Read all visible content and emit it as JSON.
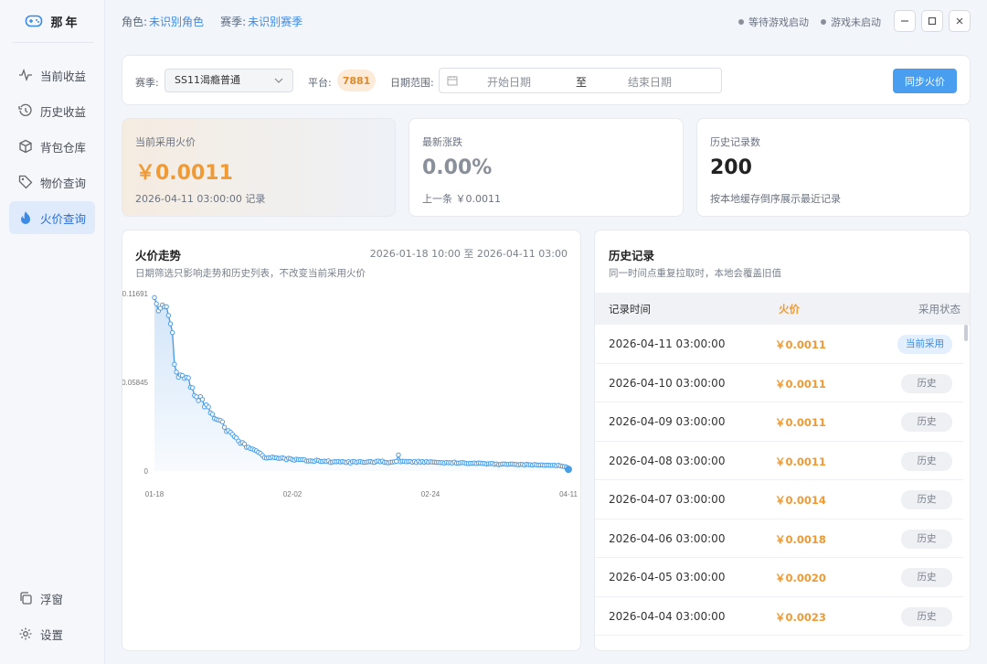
{
  "app": {
    "title": "那年"
  },
  "sidebar": {
    "items": [
      {
        "label": "当前收益",
        "icon": "pulse-icon",
        "active": false
      },
      {
        "label": "历史收益",
        "icon": "history-icon",
        "active": false
      },
      {
        "label": "背包仓库",
        "icon": "box-icon",
        "active": false
      },
      {
        "label": "物价查询",
        "icon": "tag-icon",
        "active": false
      },
      {
        "label": "火价查询",
        "icon": "flame-icon",
        "active": true
      }
    ],
    "bottom": [
      {
        "label": "浮窗",
        "icon": "copy-icon"
      },
      {
        "label": "设置",
        "icon": "gear-icon"
      }
    ]
  },
  "topbar": {
    "role_label": "角色:",
    "role_value": "未识别角色",
    "season_label": "赛季:",
    "season_value": "未识别赛季",
    "status1": "等待游戏启动",
    "status2": "游戏未启动"
  },
  "filter": {
    "season_label": "赛季:",
    "season_value": "SS11渴瘾普通",
    "platform_label": "平台:",
    "platform_value": "7881",
    "date_label": "日期范围:",
    "date_start": "开始日期",
    "date_to": "至",
    "date_end": "结束日期",
    "sync_label": "同步火价"
  },
  "cards": {
    "current": {
      "title": "当前采用火价",
      "value": "￥0.0011",
      "sub": "2026-04-11 03:00:00 记录"
    },
    "change": {
      "title": "最新涨跌",
      "value": "0.00%",
      "sub": "上一条 ￥0.0011"
    },
    "count": {
      "title": "历史记录数",
      "value": "200",
      "sub": "按本地缓存倒序展示最近记录"
    }
  },
  "chart_panel": {
    "title": "火价走势",
    "range": "2026-01-18 10:00 至 2026-04-11 03:00",
    "subtitle": "日期筛选只影响走势和历史列表，不改变当前采用火价"
  },
  "chart_data": {
    "type": "area",
    "ylim": [
      0,
      0.11691
    ],
    "yticks": [
      "0.11691",
      "0.05845",
      "0"
    ],
    "xticks": [
      "01-18",
      "02-02",
      "02-24",
      "04-11"
    ],
    "colors": {
      "line": "#4a9ee8",
      "fill": "#cfe3f8"
    },
    "values": [
      0.1143,
      0.1102,
      0.1055,
      0.1073,
      0.1094,
      0.1082,
      0.1083,
      0.1025,
      0.097,
      0.0912,
      0.0703,
      0.0652,
      0.0618,
      0.0633,
      0.0629,
      0.061,
      0.0617,
      0.0614,
      0.0552,
      0.0549,
      0.0497,
      0.0489,
      0.0464,
      0.0491,
      0.0471,
      0.0423,
      0.0436,
      0.0422,
      0.0383,
      0.0374,
      0.0346,
      0.0341,
      0.0336,
      0.0333,
      0.0324,
      0.0288,
      0.026,
      0.0266,
      0.0256,
      0.0241,
      0.0226,
      0.0218,
      0.0198,
      0.0182,
      0.0188,
      0.0178,
      0.0156,
      0.0157,
      0.0148,
      0.0145,
      0.0139,
      0.0133,
      0.0123,
      0.0116,
      0.0103,
      0.0089,
      0.0085,
      0.0088,
      0.0088,
      0.0092,
      0.0088,
      0.0088,
      0.0083,
      0.0084,
      0.0088,
      0.0083,
      0.0075,
      0.0084,
      0.0082,
      0.0075,
      0.0071,
      0.0078,
      0.0076,
      0.0076,
      0.0076,
      0.0074,
      0.0066,
      0.0066,
      0.0067,
      0.0065,
      0.0064,
      0.0072,
      0.0069,
      0.0063,
      0.0063,
      0.0066,
      0.0063,
      0.0067,
      0.0056,
      0.0059,
      0.0062,
      0.0061,
      0.0063,
      0.006,
      0.0063,
      0.006,
      0.0056,
      0.0062,
      0.0053,
      0.0062,
      0.0062,
      0.0057,
      0.0061,
      0.0062,
      0.0059,
      0.0057,
      0.0059,
      0.0061,
      0.0063,
      0.0059,
      0.0057,
      0.0064,
      0.0066,
      0.0061,
      0.0066,
      0.0057,
      0.0057,
      0.0054,
      0.0058,
      0.0059,
      0.0061,
      0.0064,
      0.0106,
      0.0061,
      0.0065,
      0.0064,
      0.0061,
      0.0063,
      0.0063,
      0.0058,
      0.0063,
      0.0056,
      0.0065,
      0.0058,
      0.0063,
      0.0057,
      0.0062,
      0.0058,
      0.0061,
      0.0059,
      0.0059,
      0.0057,
      0.0057,
      0.0055,
      0.0055,
      0.0053,
      0.0057,
      0.0055,
      0.0055,
      0.0053,
      0.0059,
      0.0052,
      0.0052,
      0.0054,
      0.0056,
      0.0054,
      0.005,
      0.0049,
      0.0051,
      0.0051,
      0.0053,
      0.0049,
      0.0053,
      0.0052,
      0.005,
      0.005,
      0.0046,
      0.0048,
      0.0049,
      0.005,
      0.0044,
      0.0047,
      0.0042,
      0.0044,
      0.0046,
      0.0047,
      0.0044,
      0.0044,
      0.0046,
      0.0046,
      0.0044,
      0.0043,
      0.0041,
      0.0044,
      0.0043,
      0.004,
      0.0045,
      0.0042,
      0.0042,
      0.0039,
      0.0043,
      0.0041,
      0.0039,
      0.004,
      0.004,
      0.0037,
      0.0039,
      0.0039,
      0.0037,
      0.0037,
      0.0038,
      0.0035,
      0.0038,
      0.0034,
      0.0031,
      0.0029,
      0.0026,
      0.0011
    ]
  },
  "history": {
    "title": "历史记录",
    "subtitle": "同一时间点重复拉取时，本地会覆盖旧值",
    "headers": {
      "time": "记录时间",
      "price": "火价",
      "status": "采用状态"
    },
    "rows": [
      {
        "time": "2026-04-11 03:00:00",
        "price": "￥0.0011",
        "status": "当前采用",
        "current": true
      },
      {
        "time": "2026-04-10 03:00:00",
        "price": "￥0.0011",
        "status": "历史",
        "current": false
      },
      {
        "time": "2026-04-09 03:00:00",
        "price": "￥0.0011",
        "status": "历史",
        "current": false
      },
      {
        "time": "2026-04-08 03:00:00",
        "price": "￥0.0011",
        "status": "历史",
        "current": false
      },
      {
        "time": "2026-04-07 03:00:00",
        "price": "￥0.0014",
        "status": "历史",
        "current": false
      },
      {
        "time": "2026-04-06 03:00:00",
        "price": "￥0.0018",
        "status": "历史",
        "current": false
      },
      {
        "time": "2026-04-05 03:00:00",
        "price": "￥0.0020",
        "status": "历史",
        "current": false
      },
      {
        "time": "2026-04-04 03:00:00",
        "price": "￥0.0023",
        "status": "历史",
        "current": false
      }
    ]
  }
}
